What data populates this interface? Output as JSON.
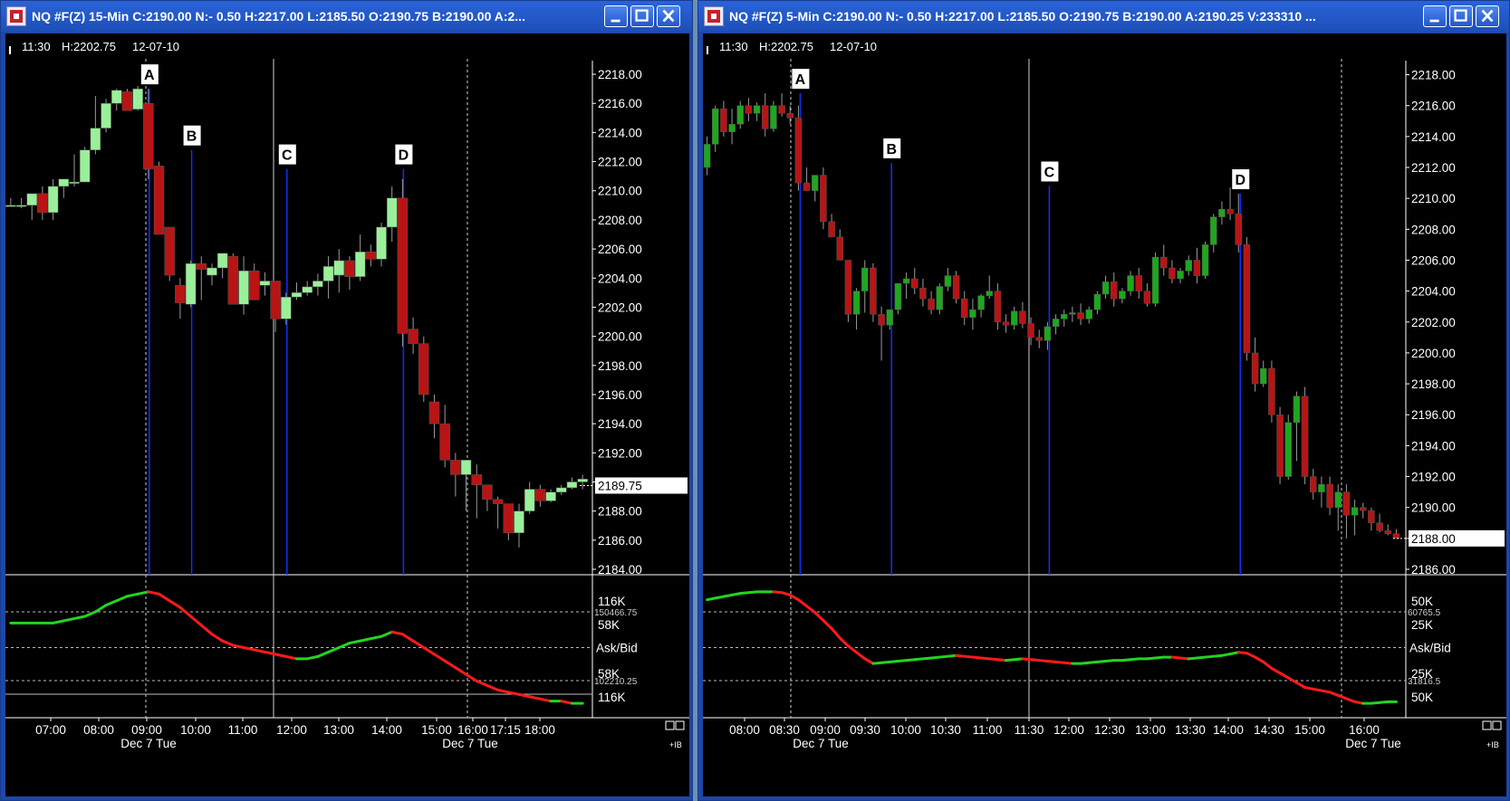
{
  "windows": [
    {
      "title": "NQ #F(Z) 15-Min C:2190.00 N:- 0.50 H:2217.00 L:2185.50 O:2190.75 B:2190.00 A:2...",
      "info": {
        "time": "11:30",
        "high": "H:2202.75",
        "date": "12-07-10"
      },
      "price_ticks": [
        "2218.00",
        "2216.00",
        "2214.00",
        "2212.00",
        "2210.00",
        "2208.00",
        "2206.00",
        "2204.00",
        "2202.00",
        "2200.00",
        "2198.00",
        "2196.00",
        "2194.00",
        "2192.00",
        "2190.00",
        "2188.00",
        "2186.00",
        "2184.00"
      ],
      "last_price": "2189.75",
      "time_ticks": [
        "07:00",
        "08:00",
        "09:00",
        "10:00",
        "11:00",
        "12:00",
        "13:00",
        "14:00",
        "15:00",
        "16:00",
        "17:15",
        "18:00"
      ],
      "date_labels": [
        "Dec 7 Tue",
        "Dec 7 Tue"
      ],
      "ind_labels": [
        "116K",
        "58K",
        "Ask/Bid",
        "58K",
        "116K"
      ],
      "ind_small": [
        "150466.75",
        "102210.25"
      ],
      "corner": "+IB",
      "markers": [
        "A",
        "B",
        "C",
        "D"
      ]
    },
    {
      "title": "NQ #F(Z) 5-Min C:2190.00 N:- 0.50 H:2217.00 L:2185.50 O:2190.75 B:2190.00 A:2190.25 V:233310 ...",
      "info": {
        "time": "11:30",
        "high": "H:2202.75",
        "date": "12-07-10"
      },
      "price_ticks": [
        "2218.00",
        "2216.00",
        "2214.00",
        "2212.00",
        "2210.00",
        "2208.00",
        "2206.00",
        "2204.00",
        "2202.00",
        "2200.00",
        "2198.00",
        "2196.00",
        "2194.00",
        "2192.00",
        "2190.00",
        "2188.00",
        "2186.00"
      ],
      "last_price": "2188.00",
      "time_ticks": [
        "08:00",
        "08:30",
        "09:00",
        "09:30",
        "10:00",
        "10:30",
        "11:00",
        "11:30",
        "12:00",
        "12:30",
        "13:00",
        "13:30",
        "14:00",
        "14:30",
        "15:00",
        "16:00"
      ],
      "date_labels": [
        "Dec 7 Tue",
        "Dec 7 Tue"
      ],
      "ind_labels": [
        "50K",
        "25K",
        "Ask/Bid",
        "25K",
        "50K"
      ],
      "ind_small": [
        "60765.5",
        "31816.5"
      ],
      "corner": "+IB",
      "markers": [
        "A",
        "B",
        "C",
        "D"
      ]
    }
  ],
  "chart_data": [
    {
      "type": "candlestick",
      "title": "NQ #F(Z) 15-Min",
      "x_label": "",
      "y_label": "",
      "ylim": [
        2184,
        2218.5
      ],
      "candles": [
        [
          2209,
          2209.5,
          2209,
          2209
        ],
        [
          2209,
          2209.5,
          2208.8,
          2209
        ],
        [
          2209,
          2209.5,
          2208,
          2209.8
        ],
        [
          2209.8,
          2210.3,
          2208,
          2208.5
        ],
        [
          2208.5,
          2210.8,
          2208,
          2210.3
        ],
        [
          2210.3,
          2210.8,
          2209.5,
          2210.8
        ],
        [
          2210.5,
          2212.5,
          2210.3,
          2210.6
        ],
        [
          2210.6,
          2213,
          2210.6,
          2212.8
        ],
        [
          2212.8,
          2216.5,
          2212.5,
          2214.3
        ],
        [
          2214.3,
          2216.3,
          2214,
          2216
        ],
        [
          2216,
          2217,
          2215.5,
          2216.9
        ],
        [
          2216.8,
          2217,
          2215.5,
          2215.5
        ],
        [
          2215.6,
          2217.2,
          2215.5,
          2217
        ],
        [
          2216,
          2217,
          2210.8,
          2211.5
        ],
        [
          2211.7,
          2212,
          2207.7,
          2207
        ],
        [
          2207.5,
          2207.5,
          2203.8,
          2204.2
        ],
        [
          2203.5,
          2204,
          2201.2,
          2202.3
        ],
        [
          2202.2,
          2205.2,
          2202,
          2205
        ],
        [
          2205,
          2205.5,
          2202.5,
          2204.6
        ],
        [
          2204.2,
          2205,
          2203.5,
          2204.7
        ],
        [
          2204.7,
          2205.7,
          2204,
          2205.7
        ],
        [
          2205.5,
          2205.7,
          2202.3,
          2202.2
        ],
        [
          2202.2,
          2205.5,
          2201.5,
          2204.5
        ],
        [
          2204.5,
          2205,
          2202.5,
          2202.5
        ],
        [
          2203.5,
          2204.4,
          2202.8,
          2203.8
        ],
        [
          2203.8,
          2203.8,
          2200.3,
          2201.2
        ],
        [
          2201.2,
          2203,
          2200.8,
          2202.7
        ],
        [
          2202.7,
          2203.7,
          2202.5,
          2203
        ],
        [
          2203,
          2203.8,
          2202.8,
          2203.4
        ],
        [
          2203.4,
          2204.3,
          2202.8,
          2203.8
        ],
        [
          2203.8,
          2205.5,
          2202.6,
          2204.8
        ],
        [
          2204.2,
          2206,
          2203,
          2205.2
        ],
        [
          2205.2,
          2205.5,
          2203.2,
          2204.1
        ],
        [
          2204.1,
          2207,
          2203.8,
          2205.8
        ],
        [
          2205.8,
          2206.3,
          2204.8,
          2205.3
        ],
        [
          2205.3,
          2207.8,
          2204.8,
          2207.5
        ],
        [
          2207.5,
          2210.3,
          2206.5,
          2209.5
        ],
        [
          2209.5,
          2210.8,
          2199.3,
          2200.2
        ],
        [
          2200.5,
          2201.3,
          2198.8,
          2199.5
        ],
        [
          2199.5,
          2200,
          2195.5,
          2196
        ],
        [
          2195.5,
          2196,
          2193,
          2194
        ],
        [
          2194,
          2195.3,
          2191,
          2191.5
        ],
        [
          2191.5,
          2192,
          2189,
          2190.5
        ],
        [
          2190.5,
          2191.5,
          2188,
          2191.5
        ],
        [
          2190.5,
          2191.2,
          2187.5,
          2189.8
        ],
        [
          2189.8,
          2189.8,
          2188,
          2188.8
        ],
        [
          2188.8,
          2189,
          2186.8,
          2188.5
        ],
        [
          2188.5,
          2188.5,
          2186,
          2186.5
        ],
        [
          2186.5,
          2188.5,
          2185.5,
          2188
        ],
        [
          2188,
          2190,
          2187.8,
          2189.5
        ],
        [
          2189.5,
          2189.8,
          2188.3,
          2188.7
        ],
        [
          2188.7,
          2189.5,
          2188.6,
          2189.3
        ],
        [
          2189.3,
          2189.8,
          2189.1,
          2189.6
        ],
        [
          2189.6,
          2190.3,
          2189.5,
          2190
        ],
        [
          2190,
          2190.5,
          2189.5,
          2190.2
        ]
      ],
      "event_lines": [
        {
          "label": "A",
          "index": 13,
          "price": 2217.0
        },
        {
          "label": "B",
          "index": 17,
          "price": 2212.8
        },
        {
          "label": "C",
          "index": 26,
          "price": 2211.5
        },
        {
          "label": "D",
          "index": 37,
          "price": 2211.5
        }
      ],
      "indicator": {
        "name": "Ask/Bid",
        "values": [
          140,
          140,
          140,
          140,
          140,
          141,
          142,
          143,
          145,
          148,
          150,
          152,
          153,
          154,
          153,
          150,
          147,
          143,
          139,
          135,
          132,
          130,
          129,
          128,
          127,
          126,
          125,
          124,
          124,
          125,
          127,
          129,
          131,
          132,
          133,
          134,
          136,
          135,
          132,
          129,
          126,
          123,
          120,
          117,
          114,
          112,
          110,
          109,
          108,
          107,
          106,
          105,
          105,
          104,
          104
        ],
        "up_color": "#22d420",
        "down_color": "#ff1a1a"
      }
    },
    {
      "type": "candlestick",
      "title": "NQ #F(Z) 5-Min",
      "x_label": "",
      "y_label": "",
      "ylim": [
        2186,
        2218.5
      ],
      "candles": [
        [
          2212,
          2214,
          2211.5,
          2213.5
        ],
        [
          2213.5,
          2216,
          2213,
          2215.8
        ],
        [
          2215.8,
          2216.3,
          2214,
          2214.3
        ],
        [
          2214.3,
          2215.8,
          2213.5,
          2214.8
        ],
        [
          2214.8,
          2216.3,
          2214.5,
          2216
        ],
        [
          2216,
          2216.5,
          2215,
          2215.5
        ],
        [
          2215.5,
          2216.2,
          2215,
          2216
        ],
        [
          2216,
          2216.8,
          2214,
          2214.5
        ],
        [
          2214.5,
          2216.3,
          2214.3,
          2216
        ],
        [
          2216,
          2216.8,
          2215.3,
          2215.5
        ],
        [
          2215.5,
          2216,
          2214.8,
          2215.2
        ],
        [
          2215.2,
          2216,
          2210.5,
          2211
        ],
        [
          2211,
          2212,
          2210.5,
          2210.5
        ],
        [
          2210.5,
          2211.5,
          2209.8,
          2211.5
        ],
        [
          2211.5,
          2212,
          2208,
          2208.5
        ],
        [
          2208.5,
          2209,
          2207.5,
          2207.5
        ],
        [
          2207.5,
          2208,
          2206,
          2206
        ],
        [
          2206,
          2206,
          2202,
          2202.5
        ],
        [
          2202.5,
          2204.2,
          2201.5,
          2204
        ],
        [
          2204,
          2206,
          2202.6,
          2205.5
        ],
        [
          2205.5,
          2205.8,
          2202,
          2202.5
        ],
        [
          2202.5,
          2203,
          2199.5,
          2201.8
        ],
        [
          2201.8,
          2202.8,
          2201.5,
          2202.8
        ],
        [
          2202.8,
          2204.5,
          2202.5,
          2204.5
        ],
        [
          2204.5,
          2205.2,
          2203.5,
          2204.8
        ],
        [
          2204.8,
          2205.5,
          2203.8,
          2204.2
        ],
        [
          2204.2,
          2204.8,
          2203,
          2203.5
        ],
        [
          2203.5,
          2204,
          2202.5,
          2202.8
        ],
        [
          2202.8,
          2204.5,
          2202.5,
          2204.3
        ],
        [
          2204.3,
          2205.5,
          2204,
          2205
        ],
        [
          2205,
          2205.3,
          2203.2,
          2203.5
        ],
        [
          2203.5,
          2204,
          2201.8,
          2202.3
        ],
        [
          2202.3,
          2203.5,
          2201.5,
          2202.8
        ],
        [
          2202.8,
          2203.8,
          2202.3,
          2203.7
        ],
        [
          2203.7,
          2205,
          2203.5,
          2204
        ],
        [
          2204,
          2204.5,
          2201.5,
          2202
        ],
        [
          2202,
          2202.5,
          2201.3,
          2201.8
        ],
        [
          2201.8,
          2203,
          2201.5,
          2202.7
        ],
        [
          2202.7,
          2203.3,
          2201.6,
          2201.9
        ],
        [
          2201.9,
          2202.3,
          2200.5,
          2201
        ],
        [
          2201,
          2201.5,
          2200.3,
          2200.8
        ],
        [
          2200.8,
          2202,
          2200.2,
          2201.7
        ],
        [
          2201.7,
          2202.5,
          2201.2,
          2202.2
        ],
        [
          2202.2,
          2202.8,
          2201.7,
          2202.5
        ],
        [
          2202.5,
          2203,
          2202,
          2202.6
        ],
        [
          2202.6,
          2203.2,
          2201.8,
          2202.2
        ],
        [
          2202.2,
          2203,
          2201.9,
          2202.8
        ],
        [
          2202.8,
          2204,
          2202.5,
          2203.8
        ],
        [
          2203.8,
          2205,
          2203.5,
          2204.6
        ],
        [
          2204.6,
          2205.2,
          2203,
          2203.5
        ],
        [
          2203.5,
          2204.2,
          2203.2,
          2204
        ],
        [
          2204,
          2205.3,
          2203.7,
          2205
        ],
        [
          2205,
          2205.5,
          2203.5,
          2204
        ],
        [
          2204,
          2204.5,
          2203,
          2203.2
        ],
        [
          2203.2,
          2206.5,
          2203,
          2206.2
        ],
        [
          2206.2,
          2207,
          2205,
          2205.5
        ],
        [
          2205.5,
          2206,
          2204.5,
          2204.8
        ],
        [
          2204.8,
          2205.5,
          2204.5,
          2205.3
        ],
        [
          2205.3,
          2206.3,
          2205,
          2206
        ],
        [
          2206,
          2206.8,
          2204.5,
          2205
        ],
        [
          2205,
          2207.2,
          2204.8,
          2207
        ],
        [
          2207,
          2209,
          2206.5,
          2208.8
        ],
        [
          2208.8,
          2209.8,
          2208.3,
          2209.3
        ],
        [
          2209.3,
          2210.7,
          2208.6,
          2209
        ],
        [
          2209,
          2210.3,
          2206.5,
          2207
        ],
        [
          2207,
          2207.5,
          2199.5,
          2200
        ],
        [
          2200,
          2201,
          2197.5,
          2198
        ],
        [
          2198,
          2199.5,
          2197.8,
          2199
        ],
        [
          2199,
          2199.5,
          2195.5,
          2196
        ],
        [
          2196,
          2196.5,
          2191.5,
          2192
        ],
        [
          2192,
          2196,
          2191.8,
          2195.5
        ],
        [
          2195.5,
          2197.5,
          2193,
          2197.2
        ],
        [
          2197.2,
          2197.8,
          2191.5,
          2192
        ],
        [
          2192,
          2192.5,
          2190.5,
          2191
        ],
        [
          2191,
          2192,
          2190,
          2191.5
        ],
        [
          2191.5,
          2192,
          2189.5,
          2190
        ],
        [
          2190,
          2191.5,
          2188.5,
          2191
        ],
        [
          2191,
          2191.5,
          2188,
          2189.5
        ],
        [
          2189.5,
          2190.5,
          2188.2,
          2190
        ],
        [
          2190,
          2190.3,
          2189.3,
          2189.8
        ],
        [
          2189.8,
          2190,
          2188.5,
          2189
        ],
        [
          2189,
          2189.6,
          2188.4,
          2188.5
        ],
        [
          2188.5,
          2188.9,
          2188.2,
          2188.3
        ],
        [
          2188.3,
          2188.6,
          2188,
          2188
        ]
      ],
      "event_lines": [
        {
          "label": "A",
          "index": 11,
          "price": 2216.8
        },
        {
          "label": "B",
          "index": 22,
          "price": 2212.3
        },
        {
          "label": "C",
          "index": 41,
          "price": 2210.8
        },
        {
          "label": "D",
          "index": 64,
          "price": 2210.3
        }
      ],
      "indicator": {
        "name": "Ask/Bid",
        "values": [
          55,
          56,
          57,
          58,
          59,
          59.5,
          60,
          60,
          60,
          59.5,
          58,
          55,
          51,
          47,
          42,
          37,
          31,
          26,
          22,
          18,
          15,
          15.5,
          16,
          16.5,
          17,
          17.5,
          18,
          18.5,
          19,
          19.5,
          20,
          19.5,
          19,
          18.5,
          18,
          17.5,
          17,
          17.5,
          18,
          17.5,
          17,
          16.5,
          16,
          15.5,
          15,
          15,
          15.5,
          16,
          16.5,
          17,
          17,
          17.5,
          18,
          18,
          18.5,
          19,
          19,
          18.5,
          18,
          18.5,
          19,
          19.5,
          20,
          21,
          22,
          21.5,
          19,
          16,
          12,
          9,
          6,
          3,
          0,
          -1,
          -2,
          -3,
          -5,
          -7,
          -9,
          -10,
          -10,
          -9.5,
          -9,
          -9
        ],
        "up_color": "#22d420",
        "down_color": "#ff1a1a"
      }
    }
  ]
}
